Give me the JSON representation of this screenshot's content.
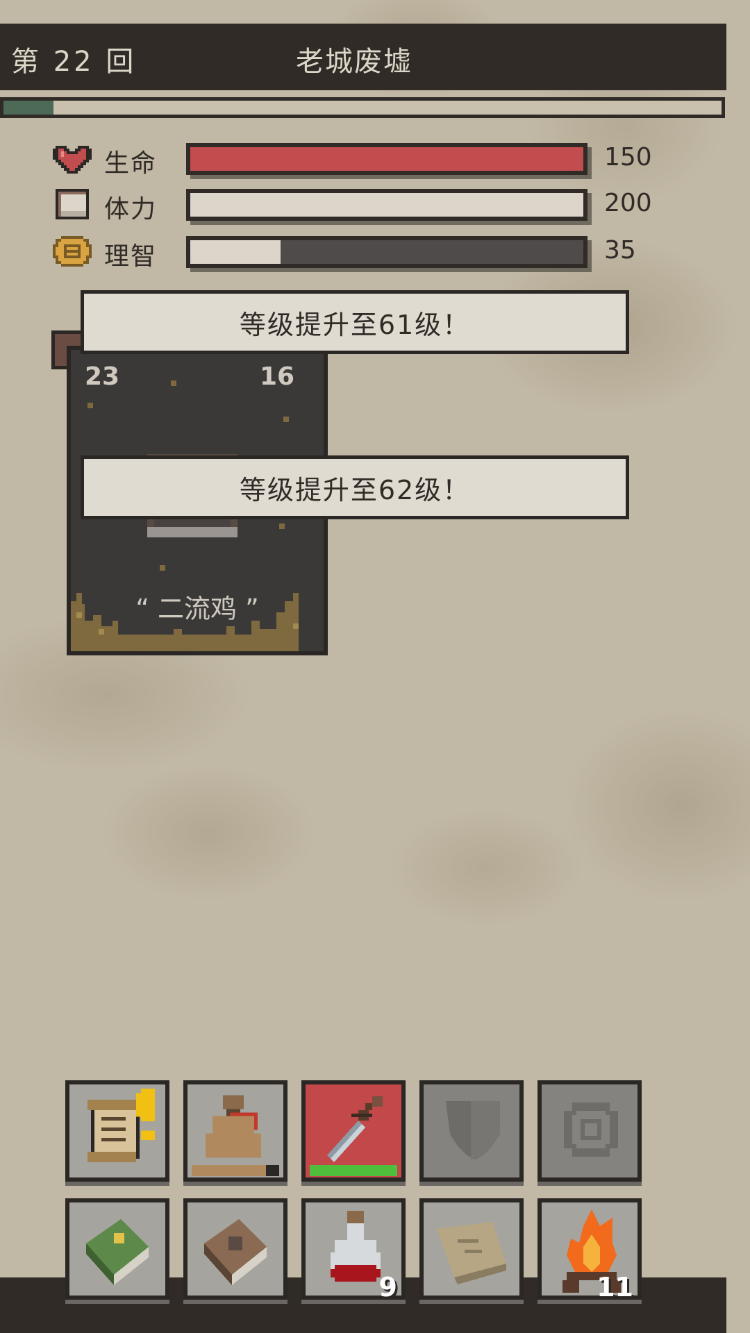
{
  "header": {
    "chapter": "第 22 回",
    "location": "老城废墟",
    "progress": 0.07
  },
  "stats": [
    {
      "id": "hp",
      "label": "生命",
      "value": "150",
      "fill": 1.0,
      "color": "#c14d4e",
      "icon": "heart-icon"
    },
    {
      "id": "stamina",
      "label": "体力",
      "value": "200",
      "fill": 1.0,
      "color": "#dcd6ca",
      "icon": "stamina-icon"
    },
    {
      "id": "sanity",
      "label": "理智",
      "value": "35",
      "fill": 0.23,
      "color": "#dcd6ca",
      "icon": "sanity-icon"
    }
  ],
  "enemy_card": {
    "left_value": "23",
    "right_value": "16",
    "name": "“ 二流鸡 ”"
  },
  "notifications": [
    "等级提升至61级！",
    "等级提升至62级！"
  ],
  "toolbar": {
    "top_row": [
      {
        "name": "quest-scroll",
        "icon": "scroll-icon",
        "alert": true
      },
      {
        "name": "loot-bag",
        "icon": "bag-icon",
        "bar": 0.85
      },
      {
        "name": "weapon",
        "icon": "dagger-icon",
        "active": true,
        "bar": 1.0
      },
      {
        "name": "armor",
        "icon": "shield-icon",
        "disabled": true
      },
      {
        "name": "trinket",
        "icon": "ring-icon",
        "disabled": true
      }
    ],
    "bottom_row": [
      {
        "name": "skill-book",
        "icon": "green-book-icon"
      },
      {
        "name": "journal",
        "icon": "brown-book-icon"
      },
      {
        "name": "potion",
        "icon": "potion-icon",
        "count": "9"
      },
      {
        "name": "map",
        "icon": "map-icon"
      },
      {
        "name": "campfire",
        "icon": "campfire-icon",
        "count": "11"
      }
    ]
  }
}
